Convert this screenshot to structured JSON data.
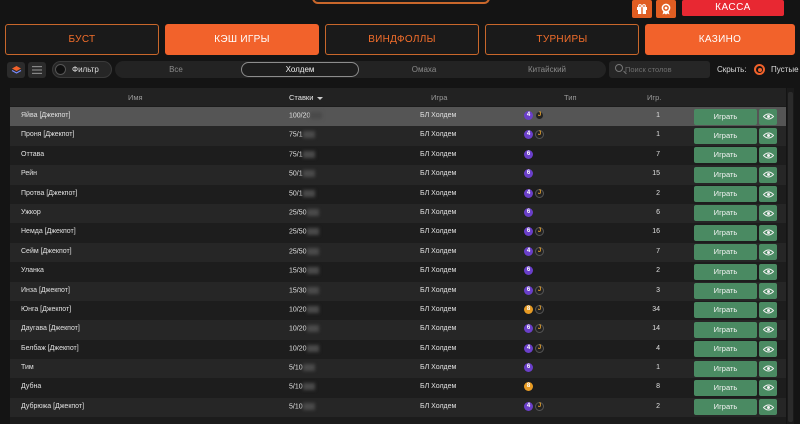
{
  "header": {
    "cashier_label": "КАССА",
    "icons": [
      "gift-icon",
      "medal-icon"
    ]
  },
  "category_tabs": [
    {
      "label": "БУСТ",
      "active": false
    },
    {
      "label": "КЭШ ИГРЫ",
      "active": true
    },
    {
      "label": "ВИНДФОЛЛЫ",
      "active": false
    },
    {
      "label": "ТУРНИРЫ",
      "active": false
    },
    {
      "label": "КАЗИНО",
      "active": true
    }
  ],
  "filters": {
    "filter_label": "Фильтр",
    "game_tabs": [
      {
        "label": "Все",
        "active": false
      },
      {
        "label": "Холдем",
        "active": true
      },
      {
        "label": "Омаха",
        "active": false
      },
      {
        "label": "Китайский",
        "active": false
      }
    ],
    "search_placeholder": "Поиск столов",
    "hide_label": "Скрыть:",
    "empty_label": "Пустые"
  },
  "table": {
    "columns": {
      "name": "Имя",
      "stakes": "Ставки",
      "game": "Игра",
      "type": "Тип",
      "players": "Игр."
    },
    "play_label": "Играть",
    "rows": [
      {
        "name": "Яйва [Джекпот]",
        "stakes": "100/20",
        "game": "БЛ Холдем",
        "seats": "4",
        "seat_color": "purple",
        "jackpot": true,
        "players": "1",
        "highlight": true
      },
      {
        "name": "Проня [Джекпот]",
        "stakes": "75/1",
        "game": "БЛ Холдем",
        "seats": "4",
        "seat_color": "purple",
        "jackpot": true,
        "players": "1"
      },
      {
        "name": "Оттава",
        "stakes": "75/1",
        "game": "БЛ Холдем",
        "seats": "6",
        "seat_color": "purple",
        "jackpot": false,
        "players": "7"
      },
      {
        "name": "Рейн",
        "stakes": "50/1",
        "game": "БЛ Холдем",
        "seats": "6",
        "seat_color": "purple",
        "jackpot": false,
        "players": "15"
      },
      {
        "name": "Протва [Джекпот]",
        "stakes": "50/1",
        "game": "БЛ Холдем",
        "seats": "4",
        "seat_color": "purple",
        "jackpot": true,
        "players": "2"
      },
      {
        "name": "Ужкор",
        "stakes": "25/50",
        "game": "БЛ Холдем",
        "seats": "6",
        "seat_color": "purple",
        "jackpot": false,
        "players": "6"
      },
      {
        "name": "Немда [Джекпот]",
        "stakes": "25/50",
        "game": "БЛ Холдем",
        "seats": "6",
        "seat_color": "purple",
        "jackpot": true,
        "players": "16"
      },
      {
        "name": "Сейм [Джекпот]",
        "stakes": "25/50",
        "game": "БЛ Холдем",
        "seats": "4",
        "seat_color": "purple",
        "jackpot": true,
        "players": "7"
      },
      {
        "name": "Уланка",
        "stakes": "15/30",
        "game": "БЛ Холдем",
        "seats": "6",
        "seat_color": "purple",
        "jackpot": false,
        "players": "2"
      },
      {
        "name": "Инза [Джекпот]",
        "stakes": "15/30",
        "game": "БЛ Холдем",
        "seats": "6",
        "seat_color": "purple",
        "jackpot": true,
        "players": "3"
      },
      {
        "name": "Юнга [Джекпот]",
        "stakes": "10/20",
        "game": "БЛ Холдем",
        "seats": "8",
        "seat_color": "orange",
        "jackpot": true,
        "players": "34"
      },
      {
        "name": "Даугава [Джекпот]",
        "stakes": "10/20",
        "game": "БЛ Холдем",
        "seats": "6",
        "seat_color": "purple",
        "jackpot": true,
        "players": "14"
      },
      {
        "name": "Белбаж [Джекпот]",
        "stakes": "10/20",
        "game": "БЛ Холдем",
        "seats": "4",
        "seat_color": "purple",
        "jackpot": true,
        "players": "4"
      },
      {
        "name": "Тим",
        "stakes": "5/10",
        "game": "БЛ Холдем",
        "seats": "6",
        "seat_color": "purple",
        "jackpot": false,
        "players": "1"
      },
      {
        "name": "Дубна",
        "stakes": "5/10",
        "game": "БЛ Холдем",
        "seats": "8",
        "seat_color": "orange",
        "jackpot": false,
        "players": "8"
      },
      {
        "name": "Дубрюжа [Джекпот]",
        "stakes": "5/10",
        "game": "БЛ Холдем",
        "seats": "4",
        "seat_color": "purple",
        "jackpot": true,
        "players": "2"
      }
    ]
  }
}
